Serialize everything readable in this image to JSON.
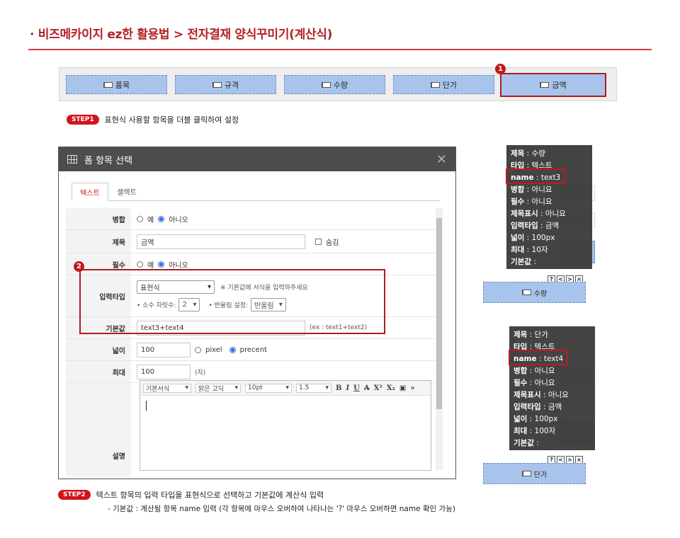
{
  "header": {
    "title": "· 비즈메카이지 ez한 활용법 > 전자결재 양식꾸미기(계산식)"
  },
  "field_bar": {
    "items": [
      {
        "label": "품목"
      },
      {
        "label": "규격"
      },
      {
        "label": "수량"
      },
      {
        "label": "단가"
      },
      {
        "label": "금액"
      }
    ],
    "badge": "1"
  },
  "step1": {
    "tag": "STEP1",
    "text": "표현식 사용할 항목을 더블 클릭하여 설정"
  },
  "dialog": {
    "title": "폼 항목 선택",
    "close": "×",
    "tabs": [
      "텍스트",
      "셀렉트"
    ],
    "merge": {
      "label": "병합",
      "opt_yes": "예",
      "opt_no": "아니오"
    },
    "subject": {
      "label": "제목",
      "value": "금액",
      "hide_label": "숨김"
    },
    "required": {
      "label": "필수",
      "opt_yes": "예",
      "opt_no": "아니오"
    },
    "badge": "2",
    "input_type": {
      "label": "입력타입",
      "value": "표현식",
      "note": "※ 기본값에 서식을 입력하주세요",
      "decimal_label": "• 소수 자릿수:",
      "decimal_value": "2",
      "round_label": "• 반올림 설정:",
      "round_value": "반올림"
    },
    "default_value": {
      "label": "기본값",
      "value": "text3+text4",
      "hint": "(ex : text1+text2)"
    },
    "width": {
      "label": "넓이",
      "value": "100",
      "opt_pixel": "pixel",
      "opt_percent": "precent"
    },
    "max": {
      "label": "최대",
      "value": "100",
      "unit": "(자)"
    },
    "description": {
      "label": "설명",
      "toolbar": {
        "format": "기본서식",
        "font": "맑은 고딕",
        "size": "10pt",
        "line": "1.5",
        "more": "»"
      }
    }
  },
  "tooltip1": {
    "lines": [
      {
        "k": "제목",
        "v": " : 수량"
      },
      {
        "k": "타입",
        "v": " : 텍스트"
      },
      {
        "k": "name",
        "v": " : text3"
      },
      {
        "k": "병합",
        "v": " : 아니요"
      },
      {
        "k": "필수",
        "v": " : 아니요"
      },
      {
        "k": "제목표시",
        "v": " : 아니요"
      },
      {
        "k": "입력타입",
        "v": " : 금액"
      },
      {
        "k": "넓이",
        "v": " : 100px"
      },
      {
        "k": "최대",
        "v": " : 10자"
      },
      {
        "k": "기본값",
        "v": " :"
      }
    ],
    "field_label": "수량",
    "icons": [
      "?",
      "<",
      ">",
      "×"
    ]
  },
  "tooltip2": {
    "lines": [
      {
        "k": "제목",
        "v": " : 단가"
      },
      {
        "k": "타입",
        "v": " : 텍스트"
      },
      {
        "k": "name",
        "v": " : text4"
      },
      {
        "k": "병합",
        "v": " : 아니요"
      },
      {
        "k": "필수",
        "v": " : 아니요"
      },
      {
        "k": "제목표시",
        "v": " : 아니요"
      },
      {
        "k": "입력타입",
        "v": " : 금액"
      },
      {
        "k": "넓이",
        "v": " : 100px"
      },
      {
        "k": "최대",
        "v": " : 100자"
      },
      {
        "k": "기본값",
        "v": " :"
      }
    ],
    "field_label": "단가",
    "icons": [
      "?",
      "<",
      ">",
      "×"
    ]
  },
  "step2": {
    "tag": "STEP2",
    "text": "텍스트 항목의 입력 타입을 표현식으로 선택하고 기본값에 계산식 입력",
    "subtext": "- 기본값 : 계산될 항목 name 입력 (각 항목에 마우스 오버하여 나타나는 '?' 마우스 오버하면 name 확인 가능)"
  }
}
